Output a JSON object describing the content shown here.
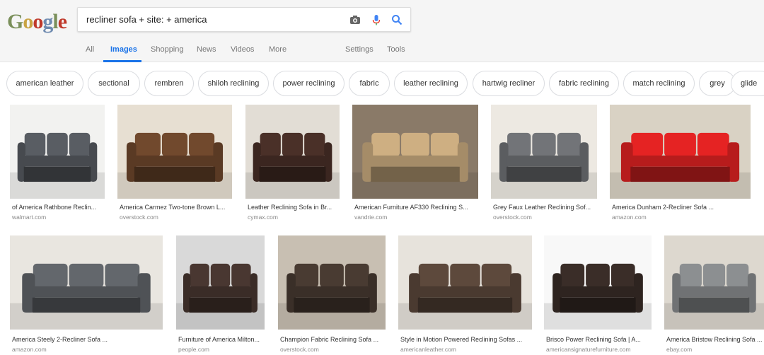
{
  "search": {
    "query": "recliner sofa + site: + america"
  },
  "logo": {
    "text": "Google"
  },
  "tabs": [
    {
      "label": "All"
    },
    {
      "label": "Images",
      "active": true
    },
    {
      "label": "Shopping"
    },
    {
      "label": "News"
    },
    {
      "label": "Videos"
    },
    {
      "label": "More"
    },
    {
      "label": "Settings"
    },
    {
      "label": "Tools"
    }
  ],
  "chips": [
    {
      "label": "american leather"
    },
    {
      "label": "sectional"
    },
    {
      "label": "rembren"
    },
    {
      "label": "shiloh reclining"
    },
    {
      "label": "power reclining"
    },
    {
      "label": "fabric"
    },
    {
      "label": "leather reclining"
    },
    {
      "label": "hartwig recliner"
    },
    {
      "label": "fabric reclining"
    },
    {
      "label": "match reclining"
    },
    {
      "label": "grey"
    },
    {
      "label": "glide"
    }
  ],
  "results": [
    {
      "title": "of America Rathbone Reclin...",
      "source": "walmart.com",
      "sofa_color": "#474a4f",
      "bg": "#f2f2f0"
    },
    {
      "title": "America Carmez Two-tone Brown L...",
      "source": "overstock.com",
      "sofa_color": "#5a3a24",
      "bg": "#e7dfd2"
    },
    {
      "title": "Leather Reclining Sofa in Br...",
      "source": "cymax.com",
      "sofa_color": "#3b2620",
      "bg": "#e2ddd5"
    },
    {
      "title": "American Furniture AF330 Reclining S...",
      "source": "vandrie.com",
      "sofa_color": "#a58c68",
      "bg": "#8a7a68"
    },
    {
      "title": "Grey Faux Leather Reclining Sof...",
      "source": "overstock.com",
      "sofa_color": "#5b5d60",
      "bg": "#ede9e2"
    },
    {
      "title": "America Dunham 2-Recliner Sofa ...",
      "source": "amazon.com",
      "sofa_color": "#b71c1c",
      "bg": "#d9d2c4"
    },
    {
      "title": "America Steely 2-Recliner Sofa ...",
      "source": "amazon.com",
      "sofa_color": "#4f5256",
      "bg": "#e9e6e0"
    },
    {
      "title": "Furniture of America Milton...",
      "source": "people.com",
      "sofa_color": "#3a2c27",
      "bg": "#d9d9d9"
    },
    {
      "title": "Champion Fabric Reclining Sofa ...",
      "source": "overstock.com",
      "sofa_color": "#3a2f28",
      "bg": "#c8bfb2"
    },
    {
      "title": "Style in Motion Powered Reclining Sofas ...",
      "source": "americanleather.com",
      "sofa_color": "#4a3a30",
      "bg": "#e7e3dc"
    },
    {
      "title": "Brisco Power Reclining Sofa | A...",
      "source": "americansignaturefurniture.com",
      "sofa_color": "#2e2420",
      "bg": "#f8f8f8"
    },
    {
      "title": "America Bristow Reclining Sofa ...",
      "source": "ebay.com",
      "sofa_color": "#707274",
      "bg": "#ddd8cf"
    }
  ],
  "colors": {
    "accent": "#1a73e8",
    "google_blue": "#4285f4",
    "google_red": "#ea4335",
    "google_yellow": "#fbbc05",
    "google_green": "#34a853"
  }
}
